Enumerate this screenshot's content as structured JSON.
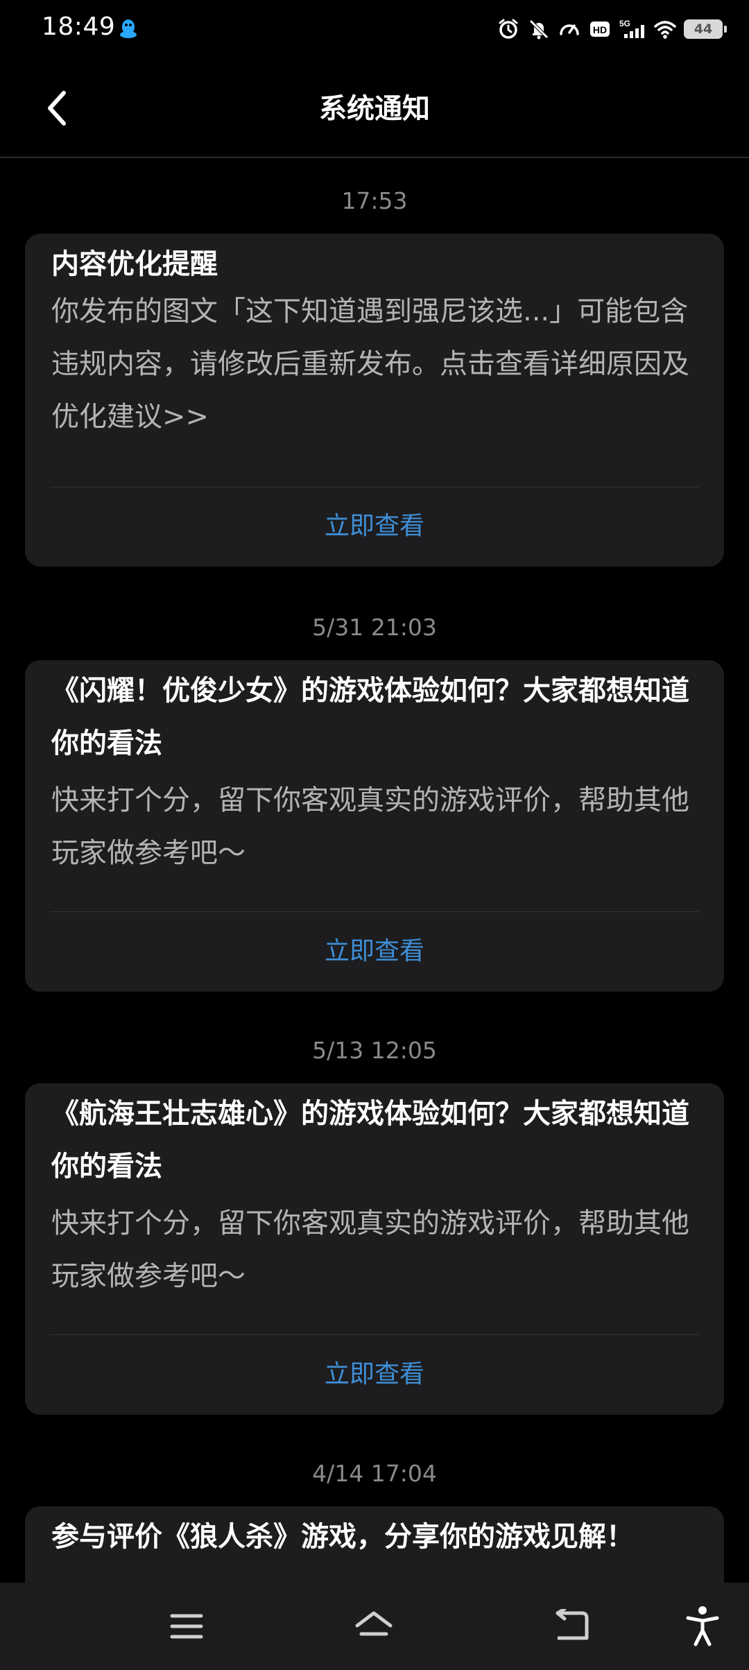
{
  "status_bar": {
    "time": "18:49",
    "left_icon": "qq-penguin-icon",
    "icons": [
      "alarm-icon",
      "mute-icon",
      "data-saver-icon",
      "hd-icon",
      "5g-signal-icon",
      "wifi-icon"
    ],
    "battery": "44",
    "accent_color": "#2aa7ff"
  },
  "header": {
    "title": "系统通知",
    "back_icon": "back-chevron-icon"
  },
  "notifications": [
    {
      "time": "17:53",
      "title": "内容优化提醒",
      "body": "你发布的图文「这下知道遇到强尼该选...」可能包含违规内容，请修改后重新发布。点击查看详细原因及优化建议>>",
      "action": "立即查看"
    },
    {
      "time": "5/31  21:03",
      "title": "《闪耀！优俊少女》的游戏体验如何？大家都想知道你的看法",
      "body": "快来打个分，留下你客观真实的游戏评价，帮助其他玩家做参考吧～",
      "action": "立即查看"
    },
    {
      "time": "5/13  12:05",
      "title": "《航海王壮志雄心》的游戏体验如何？大家都想知道你的看法",
      "body": "快来打个分，留下你客观真实的游戏评价，帮助其他玩家做参考吧～",
      "action": "立即查看"
    },
    {
      "time": "4/14  17:04",
      "title": "参与评价《狼人杀》游戏，分享你的游戏见解！",
      "body": "",
      "action": ""
    }
  ],
  "colors": {
    "background": "#000000",
    "card": "#1d1d1f",
    "link": "#3e8ed6",
    "muted_text": "#8a8a8a"
  },
  "nav_bar": {
    "icons": [
      "menu-icon",
      "home-icon",
      "back-icon",
      "accessibility-icon"
    ]
  }
}
